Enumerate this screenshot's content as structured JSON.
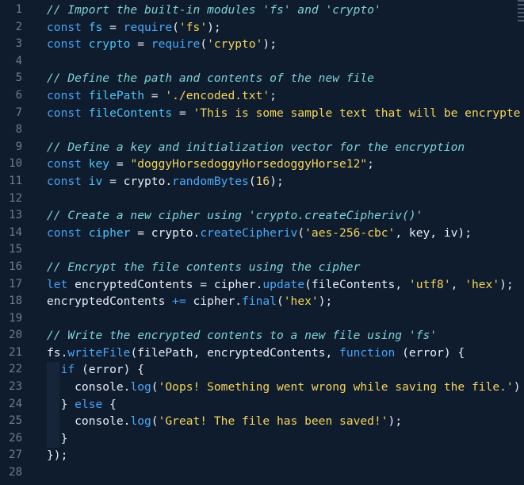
{
  "editor": {
    "line_numbers": [
      "1",
      "2",
      "3",
      "4",
      "5",
      "6",
      "7",
      "8",
      "9",
      "10",
      "11",
      "12",
      "13",
      "14",
      "15",
      "16",
      "17",
      "18",
      "19",
      "20",
      "21",
      "22",
      "23",
      "24",
      "25",
      "26",
      "27",
      "28"
    ],
    "lines": [
      [
        {
          "t": "comment",
          "v": "// Import the built-in modules 'fs' and 'crypto'"
        }
      ],
      [
        {
          "t": "kw",
          "v": "const "
        },
        {
          "t": "var",
          "v": "fs"
        },
        {
          "t": "plain",
          "v": " = "
        },
        {
          "t": "fn",
          "v": "require"
        },
        {
          "t": "plain",
          "v": "("
        },
        {
          "t": "str",
          "v": "'fs'"
        },
        {
          "t": "plain",
          "v": ");"
        }
      ],
      [
        {
          "t": "kw",
          "v": "const "
        },
        {
          "t": "var",
          "v": "crypto"
        },
        {
          "t": "plain",
          "v": " = "
        },
        {
          "t": "fn",
          "v": "require"
        },
        {
          "t": "plain",
          "v": "("
        },
        {
          "t": "str",
          "v": "'crypto'"
        },
        {
          "t": "plain",
          "v": ");"
        }
      ],
      [],
      [
        {
          "t": "comment",
          "v": "// Define the path and contents of the new file"
        }
      ],
      [
        {
          "t": "kw",
          "v": "const "
        },
        {
          "t": "var",
          "v": "filePath"
        },
        {
          "t": "plain",
          "v": " = "
        },
        {
          "t": "str",
          "v": "'./encoded.txt'"
        },
        {
          "t": "plain",
          "v": ";"
        }
      ],
      [
        {
          "t": "kw",
          "v": "const "
        },
        {
          "t": "var",
          "v": "fileContents"
        },
        {
          "t": "plain",
          "v": " = "
        },
        {
          "t": "str",
          "v": "'This is some sample text that will be encrypte"
        }
      ],
      [],
      [
        {
          "t": "comment",
          "v": "// Define a key and initialization vector for the encryption"
        }
      ],
      [
        {
          "t": "kw",
          "v": "const "
        },
        {
          "t": "var",
          "v": "key"
        },
        {
          "t": "plain",
          "v": " = "
        },
        {
          "t": "str",
          "v": "\"doggyHorsedoggyHorsedoggyHorse12\""
        },
        {
          "t": "plain",
          "v": ";"
        }
      ],
      [
        {
          "t": "kw",
          "v": "const "
        },
        {
          "t": "var",
          "v": "iv"
        },
        {
          "t": "plain",
          "v": " = crypto."
        },
        {
          "t": "fn",
          "v": "randomBytes"
        },
        {
          "t": "plain",
          "v": "("
        },
        {
          "t": "num",
          "v": "16"
        },
        {
          "t": "plain",
          "v": ");"
        }
      ],
      [],
      [
        {
          "t": "comment",
          "v": "// Create a new cipher using 'crypto.createCipheriv()'"
        }
      ],
      [
        {
          "t": "kw",
          "v": "const "
        },
        {
          "t": "var",
          "v": "cipher"
        },
        {
          "t": "plain",
          "v": " = crypto."
        },
        {
          "t": "fn",
          "v": "createCipheriv"
        },
        {
          "t": "plain",
          "v": "("
        },
        {
          "t": "str",
          "v": "'aes-256-cbc'"
        },
        {
          "t": "plain",
          "v": ", key, iv);"
        }
      ],
      [],
      [
        {
          "t": "comment",
          "v": "// Encrypt the file contents using the cipher"
        }
      ],
      [
        {
          "t": "kw",
          "v": "let "
        },
        {
          "t": "plain",
          "v": "encryptedContents = cipher."
        },
        {
          "t": "fn",
          "v": "update"
        },
        {
          "t": "plain",
          "v": "(fileContents, "
        },
        {
          "t": "str",
          "v": "'utf8'"
        },
        {
          "t": "plain",
          "v": ", "
        },
        {
          "t": "str",
          "v": "'hex'"
        },
        {
          "t": "plain",
          "v": ");"
        }
      ],
      [
        {
          "t": "plain",
          "v": "encryptedContents "
        },
        {
          "t": "kw",
          "v": "+="
        },
        {
          "t": "plain",
          "v": " cipher."
        },
        {
          "t": "fn",
          "v": "final"
        },
        {
          "t": "plain",
          "v": "("
        },
        {
          "t": "str",
          "v": "'hex'"
        },
        {
          "t": "plain",
          "v": ");"
        }
      ],
      [],
      [
        {
          "t": "comment",
          "v": "// Write the encrypted contents to a new file using 'fs'"
        }
      ],
      [
        {
          "t": "plain",
          "v": "fs."
        },
        {
          "t": "fn",
          "v": "writeFile"
        },
        {
          "t": "plain",
          "v": "(filePath, encryptedContents, "
        },
        {
          "t": "kw",
          "v": "function"
        },
        {
          "t": "plain",
          "v": " (error) {"
        }
      ],
      [
        {
          "t": "plain",
          "v": "  "
        },
        {
          "t": "kw",
          "v": "if"
        },
        {
          "t": "plain",
          "v": " (error) {"
        }
      ],
      [
        {
          "t": "plain",
          "v": "    console."
        },
        {
          "t": "fn",
          "v": "log"
        },
        {
          "t": "plain",
          "v": "("
        },
        {
          "t": "str",
          "v": "'Oops! Something went wrong while saving the file.'"
        },
        {
          "t": "plain",
          "v": ")"
        }
      ],
      [
        {
          "t": "plain",
          "v": "  } "
        },
        {
          "t": "kw",
          "v": "else"
        },
        {
          "t": "plain",
          "v": " {"
        }
      ],
      [
        {
          "t": "plain",
          "v": "    console."
        },
        {
          "t": "fn",
          "v": "log"
        },
        {
          "t": "plain",
          "v": "("
        },
        {
          "t": "str",
          "v": "'Great! The file has been saved!'"
        },
        {
          "t": "plain",
          "v": ");"
        }
      ],
      [
        {
          "t": "plain",
          "v": "  }"
        }
      ],
      [
        {
          "t": "plain",
          "v": "});"
        }
      ],
      []
    ]
  },
  "colors": {
    "background": "#0f1c2e",
    "comment": "#7fd2d8",
    "keyword": "#4aa0f2",
    "string": "#f3d55c",
    "plain": "#e6edf5",
    "line_number": "#6b7d94"
  }
}
